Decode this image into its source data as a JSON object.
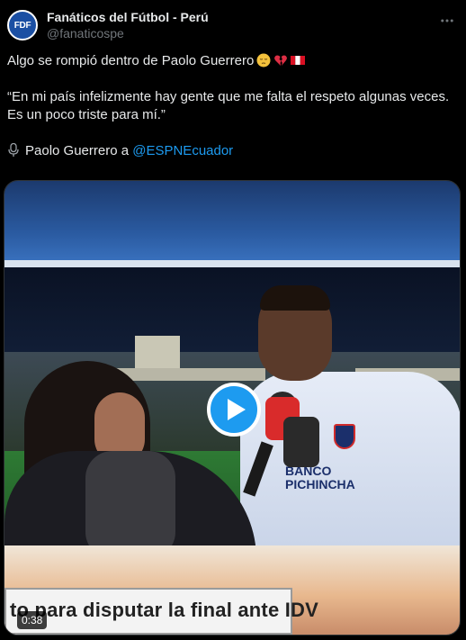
{
  "account": {
    "avatar_text": "FDF",
    "display_name": "Fanáticos del Fútbol - Perú",
    "handle": "@fanaticospe",
    "avatar_color": "#1b4fa3"
  },
  "menu_icon": "more-horizontal-icon",
  "tweet": {
    "line1": "Algo se rompió dentro de Paolo Guerrero",
    "line1_emojis": [
      "pensive-face",
      "broken-heart",
      "peru-flag"
    ],
    "quote": "“En mi país infelizmente hay gente que me falta el respeto algunas veces. Es un poco triste para mí.”",
    "credit_prefix": "Paolo Guerrero a ",
    "credit_mention": "@ESPNEcuador",
    "credit_icon": "microphone-icon"
  },
  "video": {
    "caption": "to para disputar la final ante IDV",
    "sponsor": "BANCO\nPICHINCHA",
    "duration": "0:38",
    "play_icon": "play-icon",
    "accent": "#1d9bf0"
  }
}
